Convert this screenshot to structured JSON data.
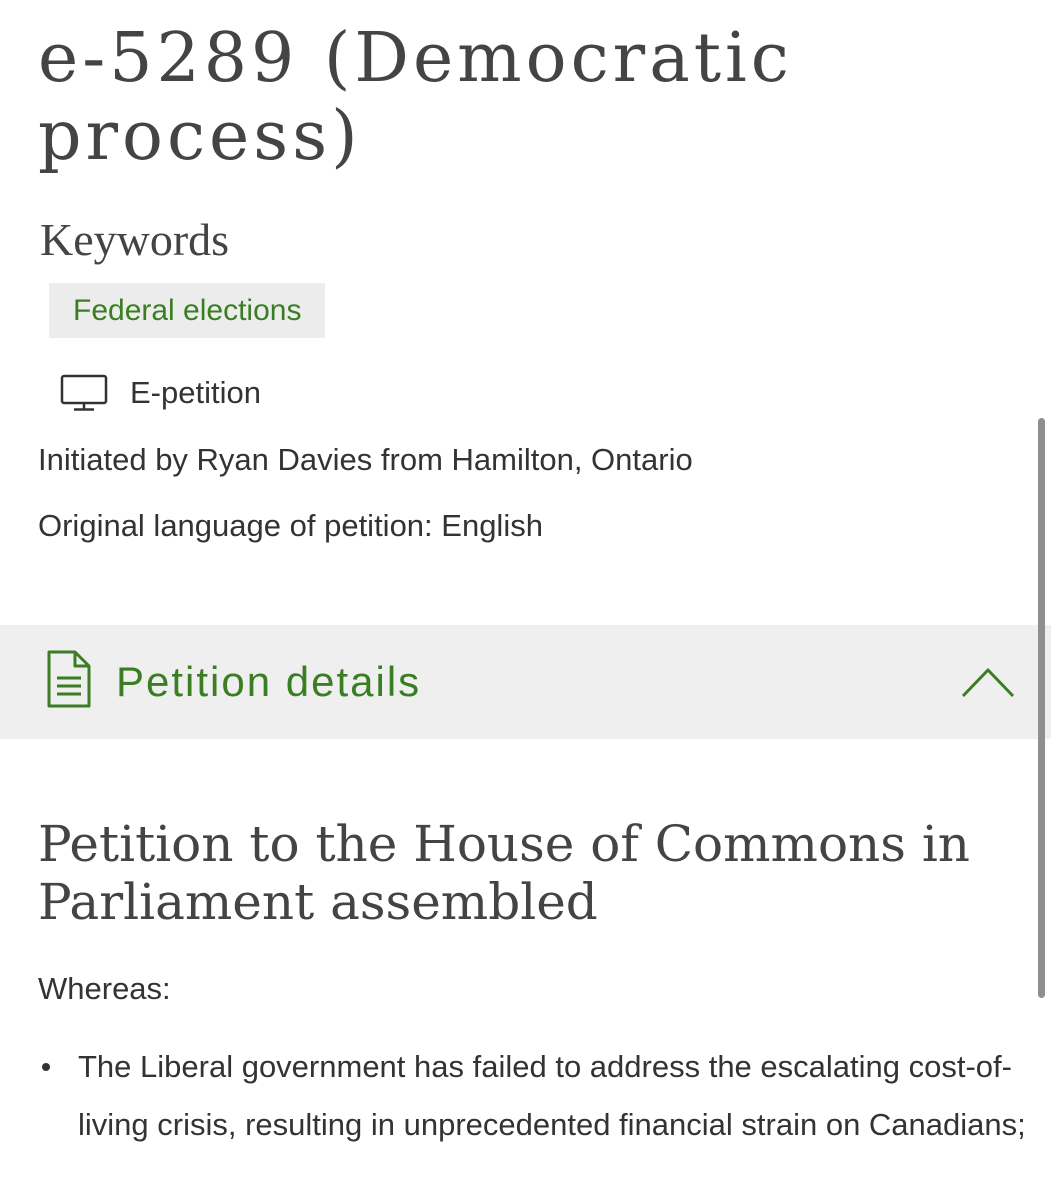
{
  "title": "e-5289 (Democratic process)",
  "keywords": {
    "heading": "Keywords",
    "tags": [
      "Federal elections"
    ]
  },
  "petition_type": {
    "icon": "monitor-icon",
    "label": "E-petition"
  },
  "initiated_by": "Initiated by Ryan Davies from Hamilton, Ontario",
  "original_language": "Original language of petition: English",
  "accordion": {
    "icon": "document-icon",
    "title": "Petition details",
    "state_icon": "chevron-up-icon",
    "expanded": true
  },
  "petition": {
    "heading": "Petition to the House of Commons in Parliament assembled",
    "whereas": "Whereas:",
    "items": [
      "The Liberal government has failed to address the escalating cost-of-living crisis, resulting in unprecedented financial strain on Canadians;"
    ]
  },
  "colors": {
    "accent": "#3a7d22",
    "text": "#333333",
    "heading": "#444444",
    "panel_bg": "#efefef",
    "tag_bg": "#ececec"
  }
}
